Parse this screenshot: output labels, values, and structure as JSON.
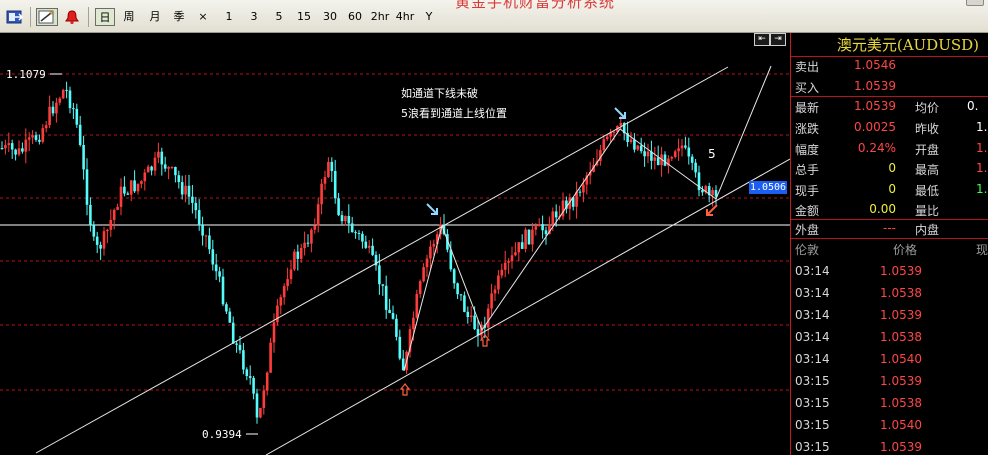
{
  "toolbar": {
    "title_overlay": "黄金手机财富分析系统",
    "timeframes": [
      {
        "label": "日",
        "active": true
      },
      {
        "label": "周"
      },
      {
        "label": "月"
      },
      {
        "label": "季"
      },
      {
        "label": "×"
      },
      {
        "label": "1"
      },
      {
        "label": "3"
      },
      {
        "label": "5"
      },
      {
        "label": "15"
      },
      {
        "label": "30"
      },
      {
        "label": "60"
      },
      {
        "label": "2hr"
      },
      {
        "label": "4hr"
      },
      {
        "label": "Y"
      }
    ]
  },
  "chart": {
    "high_label": "1.1079",
    "low_label": "0.9394",
    "current_price": "1.0506",
    "wave_label": "5",
    "annotation_line1": "如通道下线未破",
    "annotation_line2": "5浪看到通道上线位置",
    "nav_buttons": [
      "⇤",
      "⇥"
    ],
    "colors": {
      "bull": "#ff3c3c",
      "bear": "#54fcfc",
      "grid": "#b4141c",
      "channel": "#ffffff",
      "arrow_down": "#8fd8ff",
      "arrow_up": "#ff6040"
    }
  },
  "quote": {
    "symbol": "澳元美元(AUDUSD)",
    "sell_label": "卖出",
    "sell": "1.0546",
    "buy_label": "买入",
    "buy": "1.0539",
    "last_label": "最新",
    "last": "1.0539",
    "avg_label": "均价",
    "avg": "0.",
    "change_label": "涨跌",
    "change": "0.0025",
    "prev_label": "昨收",
    "prev": "1.",
    "pct_label": "幅度",
    "pct": "0.24%",
    "open_label": "开盘",
    "open": "1.",
    "volume_label": "总手",
    "volume": "0",
    "high_label": "最高",
    "high": "1.",
    "cur_vol_label": "现手",
    "cur_vol": "0",
    "low_label": "最低",
    "low": "1.",
    "amount_label": "金额",
    "amount": "0.00",
    "ratio_label": "量比",
    "outer_label": "外盘",
    "outer": "---",
    "inner_label": "内盘"
  },
  "ticks": {
    "headers": [
      "伦敦",
      "价格",
      "现"
    ],
    "rows": [
      {
        "time": "03:14",
        "price": "1.0539"
      },
      {
        "time": "03:14",
        "price": "1.0538"
      },
      {
        "time": "03:14",
        "price": "1.0539"
      },
      {
        "time": "03:14",
        "price": "1.0538"
      },
      {
        "time": "03:14",
        "price": "1.0540"
      },
      {
        "time": "03:15",
        "price": "1.0539"
      },
      {
        "time": "03:15",
        "price": "1.0538"
      },
      {
        "time": "03:15",
        "price": "1.0540"
      },
      {
        "time": "03:15",
        "price": "1.0539"
      }
    ]
  }
}
